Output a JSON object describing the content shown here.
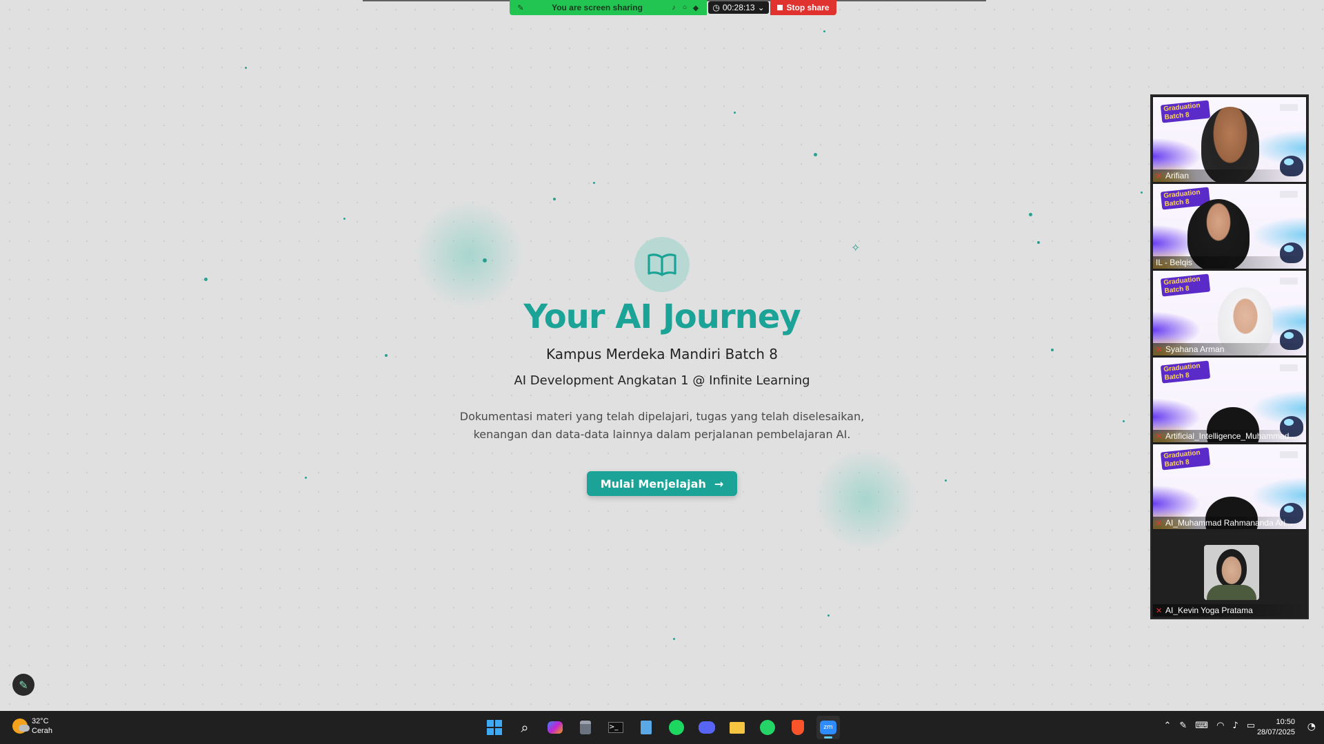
{
  "share_bar": {
    "status_text": "You are screen sharing",
    "timer": "00:28:13",
    "stop_label": "Stop share"
  },
  "hero": {
    "icon": "open-book-icon",
    "title": "Your AI Journey",
    "subtitle": "Kampus Merdeka Mandiri Batch 8",
    "tagline": "AI Development Angkatan 1 @ Infinite Learning",
    "description": "Dokumentasi materi yang telah dipelajari, tugas yang telah diselesaikan, kenangan dan data-data lainnya dalam perjalanan pembelajaran AI.",
    "cta_label": "Mulai Menjelajah",
    "cta_arrow": "→",
    "accent_color": "#1aa396"
  },
  "participants": [
    {
      "name": "Arifian",
      "badge": "Graduation Batch 8",
      "active": false
    },
    {
      "name": "IL - Belqis",
      "badge": "Graduation Batch 8",
      "active": true
    },
    {
      "name": "Syahana Arman",
      "badge": "Graduation Batch 8",
      "active": false
    },
    {
      "name": "Artificial_Intelligence_Muhammad...",
      "badge": "Graduation Batch 8",
      "active": false
    },
    {
      "name": "AI_Muhammad Rahmananda Ari...",
      "badge": "Graduation Batch 8",
      "active": false
    },
    {
      "name": "AI_Kevin Yoga Pratama",
      "active": false
    }
  ],
  "taskbar": {
    "weather_temp": "32°C",
    "weather_desc": "Cerah",
    "apps": [
      "start-icon",
      "search-icon",
      "copilot-icon",
      "calculator-icon",
      "terminal-icon",
      "notepad-icon",
      "spotify-icon",
      "discord-icon",
      "file-explorer-icon",
      "whatsapp-icon",
      "brave-icon",
      "zoom-icon"
    ],
    "time": "10:50",
    "date": "28/07/2025"
  }
}
